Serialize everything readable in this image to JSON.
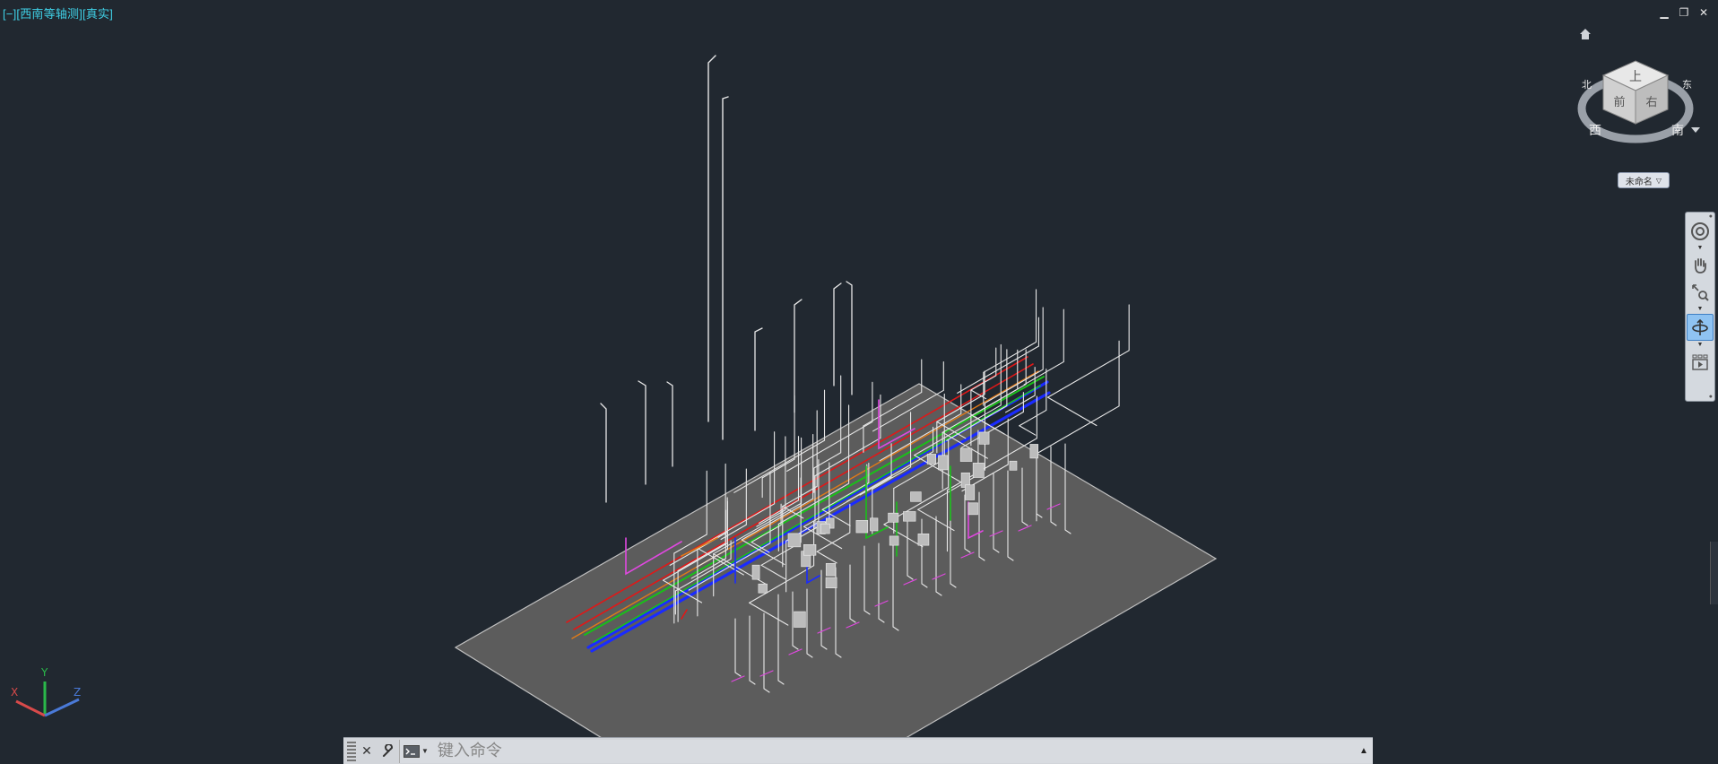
{
  "viewport": {
    "control": "[−]",
    "view": "[西南等轴测]",
    "visual_style": "[真实]"
  },
  "window_controls": {
    "minimize": "▁",
    "restore": "❐",
    "close": "✕"
  },
  "viewcube": {
    "faces": {
      "top": "上",
      "front": "前",
      "right": "右"
    },
    "compass": {
      "west": "西",
      "south": "南",
      "east": "东",
      "north": "北"
    },
    "ucs_menu_label": "未命名"
  },
  "navbar": {
    "tools": [
      "full-navigation-wheel",
      "pan",
      "zoom-extents",
      "orbit",
      "showmotion"
    ],
    "active_tool": "orbit"
  },
  "ucs": {
    "x": "X",
    "y": "Y",
    "z": "Z"
  },
  "command_line": {
    "placeholder": "键入命令"
  },
  "colors": {
    "background": "#212830",
    "ground_plane": "#5c5c5c",
    "pipe_white": "#e8e8e8",
    "pipe_red": "#e01818",
    "pipe_green": "#19c019",
    "pipe_blue": "#1a2bff",
    "pipe_magenta": "#e048e0",
    "pipe_orange": "#e07a18",
    "label_cyan": "#3fd0e6"
  }
}
